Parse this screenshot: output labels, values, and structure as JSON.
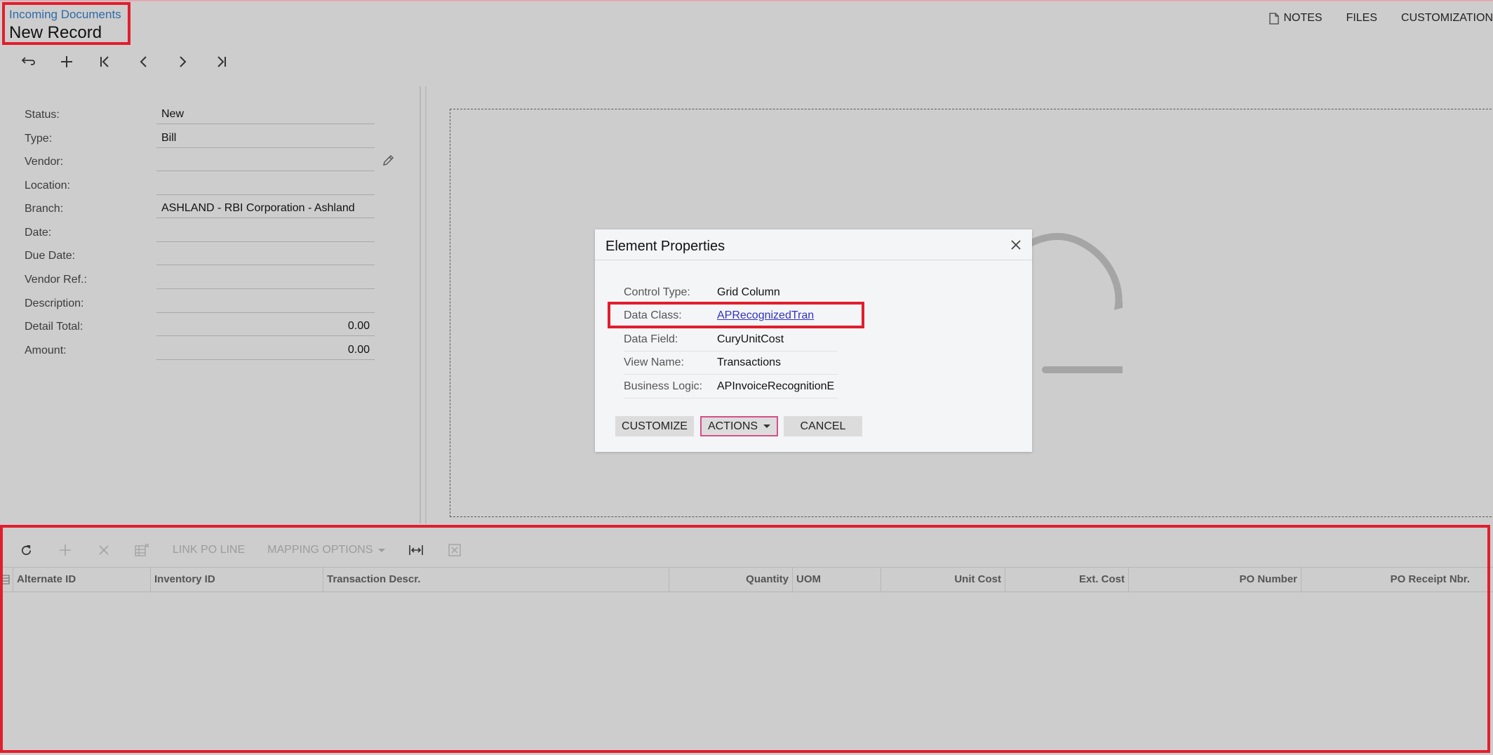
{
  "header": {
    "breadcrumb": "Incoming Documents",
    "title": "New Record",
    "links": [
      {
        "label": "NOTES",
        "icon": "notes-icon"
      },
      {
        "label": "FILES"
      },
      {
        "label": "CUSTOMIZATION"
      }
    ]
  },
  "nav_toolbar": [
    "undo-icon",
    "add-icon",
    "first-record-icon",
    "previous-record-icon",
    "next-record-icon",
    "last-record-icon"
  ],
  "form": {
    "fields": [
      {
        "label": "Status:",
        "value": "New"
      },
      {
        "label": "Type:",
        "value": "Bill"
      },
      {
        "label": "Vendor:",
        "value": ""
      },
      {
        "label": "Location:",
        "value": ""
      },
      {
        "label": "Branch:",
        "value": "ASHLAND - RBI Corporation - Ashland"
      },
      {
        "label": "Date:",
        "value": ""
      },
      {
        "label": "Due Date:",
        "value": ""
      },
      {
        "label": "Vendor Ref.:",
        "value": ""
      },
      {
        "label": "Description:",
        "value": ""
      },
      {
        "label": "Detail Total:",
        "value": "0.00"
      },
      {
        "label": "Amount:",
        "value": "0.00"
      }
    ]
  },
  "grid": {
    "toolbar": {
      "link_po_line": "LINK PO LINE",
      "mapping_options": "MAPPING OPTIONS"
    },
    "columns": [
      {
        "label": "Alternate ID"
      },
      {
        "label": "Inventory ID"
      },
      {
        "label": "Transaction Descr."
      },
      {
        "label": "Quantity"
      },
      {
        "label": "UOM"
      },
      {
        "label": "Unit Cost"
      },
      {
        "label": "Ext. Cost"
      },
      {
        "label": "PO Number"
      },
      {
        "label": "PO Receipt Nbr."
      }
    ]
  },
  "dialog": {
    "title": "Element Properties",
    "properties": [
      {
        "label": "Control Type:",
        "value": "Grid Column"
      },
      {
        "label": "Data Class:",
        "value": "APRecognizedTran"
      },
      {
        "label": "Data Field:",
        "value": "CuryUnitCost"
      },
      {
        "label": "View Name:",
        "value": "Transactions"
      },
      {
        "label": "Business Logic:",
        "value": "APInvoiceRecognitionE"
      }
    ],
    "buttons": {
      "customize": "CUSTOMIZE",
      "actions": "ACTIONS",
      "cancel": "CANCEL"
    }
  },
  "colors": {
    "highlight": "#e21e2d",
    "link": "#3232c0",
    "breadcrumb": "#2f6aa8"
  }
}
